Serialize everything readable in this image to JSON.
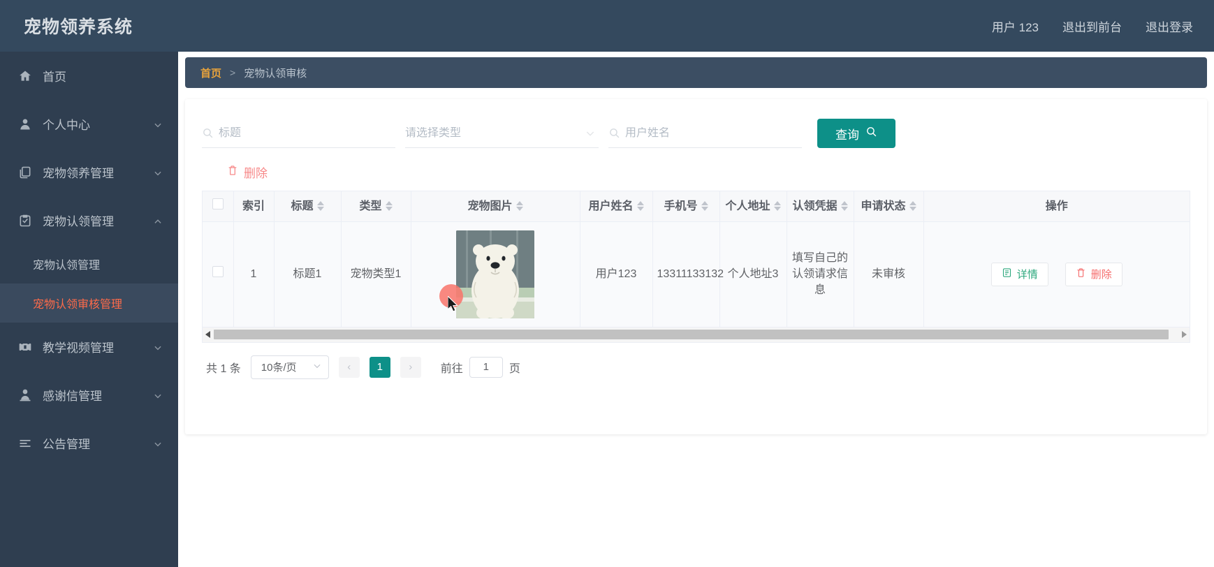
{
  "header": {
    "brand": "宠物领养系统",
    "nav": [
      {
        "label": "用户 123",
        "name": "user-label"
      },
      {
        "label": "退出到前台",
        "name": "exit-to-front"
      },
      {
        "label": "退出登录",
        "name": "logout"
      }
    ]
  },
  "sidebar": {
    "items": [
      {
        "label": "首页",
        "icon": "home-icon",
        "expandable": false
      },
      {
        "label": "个人中心",
        "icon": "user-icon",
        "expandable": true,
        "expanded": false
      },
      {
        "label": "宠物领养管理",
        "icon": "copy-icon",
        "expandable": true,
        "expanded": false
      },
      {
        "label": "宠物认领管理",
        "icon": "clipboard-check-icon",
        "expandable": true,
        "expanded": true
      },
      {
        "label": "教学视频管理",
        "icon": "film-icon",
        "expandable": true,
        "expanded": false
      },
      {
        "label": "感谢信管理",
        "icon": "person-icon",
        "expandable": true,
        "expanded": false
      },
      {
        "label": "公告管理",
        "icon": "list-icon",
        "expandable": true,
        "expanded": false
      }
    ],
    "submenu": [
      {
        "label": "宠物认领管理",
        "active": false
      },
      {
        "label": "宠物认领审核管理",
        "active": true
      }
    ]
  },
  "breadcrumb": {
    "home": "首页",
    "separator": ">",
    "current": "宠物认领审核"
  },
  "filters": {
    "title_placeholder": "标题",
    "title_value": "",
    "type_placeholder": "请选择类型",
    "type_value": "",
    "username_placeholder": "用户姓名",
    "username_value": "",
    "search_button": "查询"
  },
  "toolbar": {
    "delete_label": "删除"
  },
  "table": {
    "columns": [
      {
        "label": "",
        "name": "select-all",
        "sortable": false
      },
      {
        "label": "索引",
        "name": "index",
        "sortable": false
      },
      {
        "label": "标题",
        "name": "title",
        "sortable": true
      },
      {
        "label": "类型",
        "name": "type",
        "sortable": true
      },
      {
        "label": "宠物图片",
        "name": "pet-image",
        "sortable": true
      },
      {
        "label": "用户姓名",
        "name": "user-name",
        "sortable": true
      },
      {
        "label": "手机号",
        "name": "phone",
        "sortable": true
      },
      {
        "label": "个人地址",
        "name": "address",
        "sortable": true
      },
      {
        "label": "认领凭据",
        "name": "credential",
        "sortable": true
      },
      {
        "label": "申请状态",
        "name": "status",
        "sortable": true
      },
      {
        "label": "操作",
        "name": "actions",
        "sortable": false
      }
    ],
    "rows": [
      {
        "index": "1",
        "title": "标题1",
        "type": "宠物类型1",
        "image_alt": "pet-photo",
        "user_name": "用户123",
        "phone": "13311133132",
        "address": "个人地址3",
        "credential": "填写自己的认领请求信息",
        "status": "未审核",
        "detail_label": "详情",
        "delete_label": "删除"
      }
    ]
  },
  "pagination": {
    "total_text": "共 1 条",
    "page_size": "10条/页",
    "prev": "‹",
    "next": "›",
    "pages": [
      "1"
    ],
    "current_page": "1",
    "jump_prefix": "前往",
    "jump_value": "1",
    "jump_suffix": "页"
  },
  "colors": {
    "sidebar_bg": "#2f3e50",
    "topbar_bg": "#34495e",
    "accent_teal": "#0d9088",
    "accent_orange": "#e6a23c",
    "active_orange": "#ff6b4a",
    "danger_red": "#f56c6c",
    "success_green": "#2ea87e"
  }
}
